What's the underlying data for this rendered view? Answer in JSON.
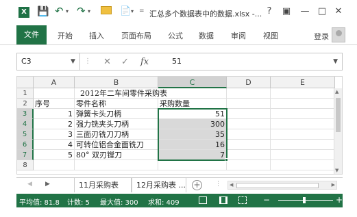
{
  "title_bar": {
    "app_logo": "X",
    "title": "汇总多个数据表中的数据.xlsx -...",
    "help": "?",
    "minimize": "—",
    "restore": "□",
    "close": "✕"
  },
  "ribbon": {
    "tabs": [
      "文件",
      "开始",
      "插入",
      "页面布局",
      "公式",
      "数据",
      "审阅",
      "视图"
    ],
    "login": "登录"
  },
  "formula_bar": {
    "name_box": "C3",
    "fx": "fx",
    "value": "51"
  },
  "grid": {
    "columns": [
      "A",
      "B",
      "C",
      "D",
      "E"
    ],
    "rows": [
      "1",
      "2",
      "3",
      "4",
      "5",
      "6",
      "7",
      "8"
    ],
    "title": "2012年二车间零件采购表",
    "headers": {
      "a": "序号",
      "b": "零件名称",
      "c": "采购数量"
    },
    "data": [
      {
        "no": "1",
        "name": "弹簧卡头刀柄",
        "qty": "51"
      },
      {
        "no": "2",
        "name": "强力铣夹头刀柄",
        "qty": "300"
      },
      {
        "no": "3",
        "name": "三面刃铣刀刀柄",
        "qty": "35"
      },
      {
        "no": "4",
        "name": "可转位铝合金面铣刀",
        "qty": "16"
      },
      {
        "no": "5",
        "name": "80° 双刃镗刀",
        "qty": "7"
      }
    ]
  },
  "sheets": {
    "tabs": [
      "11月采购表",
      "12月采购表 ..."
    ],
    "add": "+"
  },
  "status": {
    "average": "平均值: 81.8",
    "count": "计数: 5",
    "max": "最大值: 300",
    "sum": "求和: 409",
    "zoom_minus": "−",
    "zoom_plus": "+"
  },
  "colors": {
    "accent": "#217346",
    "selection_fill": "#d9d9d9"
  }
}
